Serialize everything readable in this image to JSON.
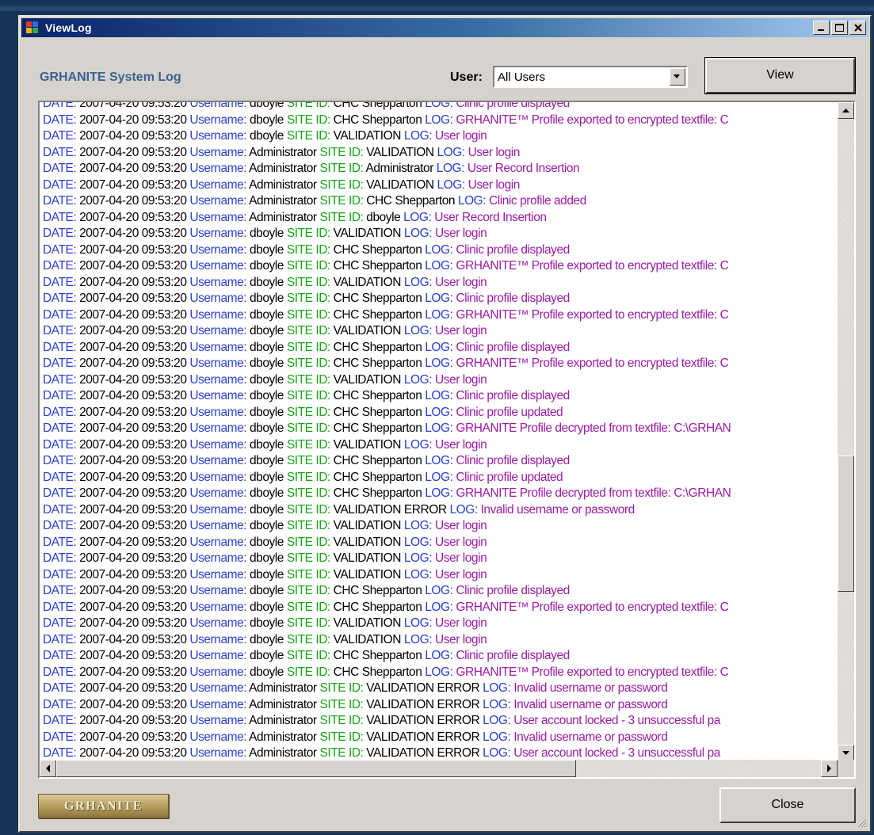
{
  "window": {
    "title": "ViewLog"
  },
  "header": {
    "log_title": "GRHANITE System Log",
    "user_label": "User:",
    "user_value": "All Users",
    "view_label": "View"
  },
  "footer": {
    "close_label": "Close",
    "logo_text": "GRHANITE"
  },
  "labels": {
    "date": "DATE:",
    "username": "Username:",
    "site": "SITE ID:",
    "log": "LOG:"
  },
  "log_entries": [
    {
      "date": "2007-04-20 09:53:20",
      "user": "dboyle",
      "site": "CHC Shepparton",
      "msg": "Clinic profile displayed"
    },
    {
      "date": "2007-04-20 09:53:20",
      "user": "dboyle",
      "site": "CHC Shepparton",
      "msg": "GRHANITE™ Profile exported to encrypted textfile: C"
    },
    {
      "date": "2007-04-20 09:53:20",
      "user": "dboyle",
      "site": "VALIDATION",
      "msg": "User login"
    },
    {
      "date": "2007-04-20 09:53:20",
      "user": "Administrator",
      "site": "VALIDATION",
      "msg": "User login"
    },
    {
      "date": "2007-04-20 09:53:20",
      "user": "Administrator",
      "site": "Administrator",
      "msg": "User Record Insertion"
    },
    {
      "date": "2007-04-20 09:53:20",
      "user": "Administrator",
      "site": "VALIDATION",
      "msg": "User login"
    },
    {
      "date": "2007-04-20 09:53:20",
      "user": "Administrator",
      "site": "CHC Shepparton",
      "msg": "Clinic profile added"
    },
    {
      "date": "2007-04-20 09:53:20",
      "user": "Administrator",
      "site": "dboyle",
      "msg": "User Record Insertion"
    },
    {
      "date": "2007-04-20 09:53:20",
      "user": "dboyle",
      "site": "VALIDATION",
      "msg": "User login"
    },
    {
      "date": "2007-04-20 09:53:20",
      "user": "dboyle",
      "site": "CHC Shepparton",
      "msg": "Clinic profile displayed"
    },
    {
      "date": "2007-04-20 09:53:20",
      "user": "dboyle",
      "site": "CHC Shepparton",
      "msg": "GRHANITE™ Profile exported to encrypted textfile: C"
    },
    {
      "date": "2007-04-20 09:53:20",
      "user": "dboyle",
      "site": "VALIDATION",
      "msg": "User login"
    },
    {
      "date": "2007-04-20 09:53:20",
      "user": "dboyle",
      "site": "CHC Shepparton",
      "msg": "Clinic profile displayed"
    },
    {
      "date": "2007-04-20 09:53:20",
      "user": "dboyle",
      "site": "CHC Shepparton",
      "msg": "GRHANITE™ Profile exported to encrypted textfile: C"
    },
    {
      "date": "2007-04-20 09:53:20",
      "user": "dboyle",
      "site": "VALIDATION",
      "msg": "User login"
    },
    {
      "date": "2007-04-20 09:53:20",
      "user": "dboyle",
      "site": "CHC Shepparton",
      "msg": "Clinic profile displayed"
    },
    {
      "date": "2007-04-20 09:53:20",
      "user": "dboyle",
      "site": "CHC Shepparton",
      "msg": "GRHANITE™ Profile exported to encrypted textfile: C"
    },
    {
      "date": "2007-04-20 09:53:20",
      "user": "dboyle",
      "site": "VALIDATION",
      "msg": "User login"
    },
    {
      "date": "2007-04-20 09:53:20",
      "user": "dboyle",
      "site": "CHC Shepparton",
      "msg": "Clinic profile displayed"
    },
    {
      "date": "2007-04-20 09:53:20",
      "user": "dboyle",
      "site": "CHC Shepparton",
      "msg": "Clinic profile updated"
    },
    {
      "date": "2007-04-20 09:53:20",
      "user": "dboyle",
      "site": "CHC Shepparton",
      "msg": "GRHANITE Profile decrypted from textfile: C:\\GRHAN"
    },
    {
      "date": "2007-04-20 09:53:20",
      "user": "dboyle",
      "site": "VALIDATION",
      "msg": "User login"
    },
    {
      "date": "2007-04-20 09:53:20",
      "user": "dboyle",
      "site": "CHC Shepparton",
      "msg": "Clinic profile displayed"
    },
    {
      "date": "2007-04-20 09:53:20",
      "user": "dboyle",
      "site": "CHC Shepparton",
      "msg": "Clinic profile updated"
    },
    {
      "date": "2007-04-20 09:53:20",
      "user": "dboyle",
      "site": "CHC Shepparton",
      "msg": "GRHANITE Profile decrypted from textfile: C:\\GRHAN"
    },
    {
      "date": "2007-04-20 09:53:20",
      "user": "dboyle",
      "site": "VALIDATION ERROR",
      "msg": "Invalid username or password"
    },
    {
      "date": "2007-04-20 09:53:20",
      "user": "dboyle",
      "site": "VALIDATION",
      "msg": "User login"
    },
    {
      "date": "2007-04-20 09:53:20",
      "user": "dboyle",
      "site": "VALIDATION",
      "msg": "User login"
    },
    {
      "date": "2007-04-20 09:53:20",
      "user": "dboyle",
      "site": "VALIDATION",
      "msg": "User login"
    },
    {
      "date": "2007-04-20 09:53:20",
      "user": "dboyle",
      "site": "VALIDATION",
      "msg": "User login"
    },
    {
      "date": "2007-04-20 09:53:20",
      "user": "dboyle",
      "site": "CHC Shepparton",
      "msg": "Clinic profile displayed"
    },
    {
      "date": "2007-04-20 09:53:20",
      "user": "dboyle",
      "site": "CHC Shepparton",
      "msg": "GRHANITE™ Profile exported to encrypted textfile: C"
    },
    {
      "date": "2007-04-20 09:53:20",
      "user": "dboyle",
      "site": "VALIDATION",
      "msg": "User login"
    },
    {
      "date": "2007-04-20 09:53:20",
      "user": "dboyle",
      "site": "VALIDATION",
      "msg": "User login"
    },
    {
      "date": "2007-04-20 09:53:20",
      "user": "dboyle",
      "site": "CHC Shepparton",
      "msg": "Clinic profile displayed"
    },
    {
      "date": "2007-04-20 09:53:20",
      "user": "dboyle",
      "site": "CHC Shepparton",
      "msg": "GRHANITE™ Profile exported to encrypted textfile: C"
    },
    {
      "date": "2007-04-20 09:53:20",
      "user": "Administrator",
      "site": "VALIDATION ERROR",
      "msg": "Invalid username or password"
    },
    {
      "date": "2007-04-20 09:53:20",
      "user": "Administrator",
      "site": "VALIDATION ERROR",
      "msg": "Invalid username or password"
    },
    {
      "date": "2007-04-20 09:53:20",
      "user": "Administrator",
      "site": "VALIDATION ERROR",
      "msg": "User account locked - 3 unsuccessful pa"
    },
    {
      "date": "2007-04-20 09:53:20",
      "user": "Administrator",
      "site": "VALIDATION ERROR",
      "msg": "Invalid username or password"
    },
    {
      "date": "2007-04-20 09:53:20",
      "user": "Administrator",
      "site": "VALIDATION ERROR",
      "msg": "User account locked - 3 unsuccessful pa"
    }
  ],
  "colors": {
    "titlebar_start": "#0a246a",
    "titlebar_end": "#a6caf0",
    "label_blue": "#2b3fd1",
    "site_green": "#16a416",
    "message_purple": "#9b1ca5",
    "heading_blue": "#3a6391"
  },
  "icons": {
    "window_icon": "app-icon",
    "minimize": "minimize-icon",
    "maximize": "maximize-icon",
    "close": "close-icon",
    "dropdown": "chevron-down-icon",
    "resize": "resize-grip-icon"
  }
}
